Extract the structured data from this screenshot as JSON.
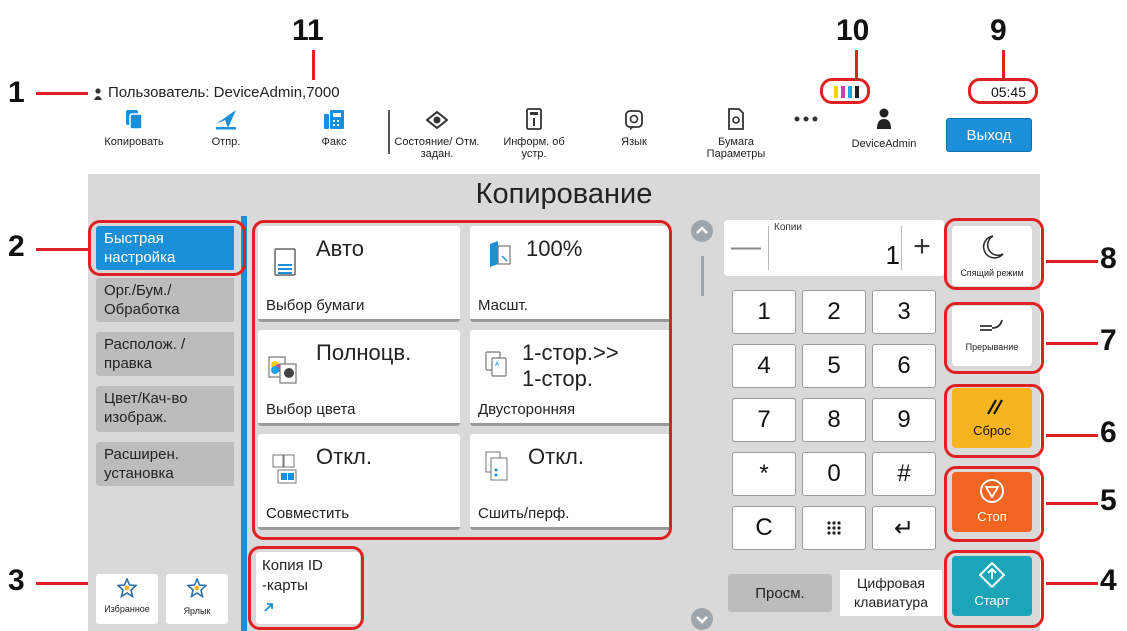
{
  "callouts": [
    "1",
    "2",
    "3",
    "4",
    "5",
    "6",
    "7",
    "8",
    "9",
    "10",
    "11"
  ],
  "status": {
    "user_text": "Пользователь: DeviceAdmin,7000",
    "time": "05:45",
    "toner_colors": [
      "#f2d200",
      "#d63bb0",
      "#1aa5e6",
      "#222222"
    ]
  },
  "toolbar": {
    "items": [
      {
        "label": "Копировать",
        "icon": "copy-icon"
      },
      {
        "label": "Отпр.",
        "icon": "send-icon"
      },
      {
        "label": "Факс",
        "icon": "fax-icon"
      },
      {
        "label": "Состояние/ Отм. задан.",
        "icon": "status-eye-icon"
      },
      {
        "label": "Информ. об устр.",
        "icon": "device-info-icon"
      },
      {
        "label": "Язык",
        "icon": "language-icon"
      },
      {
        "label": "Бумага Параметры",
        "icon": "paper-settings-icon"
      },
      {
        "label": "",
        "icon": "more-icon"
      },
      {
        "label": "DeviceAdmin",
        "icon": "user-icon"
      }
    ],
    "exit_label": "Выход"
  },
  "page_title": "Копирование",
  "tabs": [
    {
      "label": "Быстрая настройка",
      "active": true
    },
    {
      "label": "Орг./Бум./ Обработка"
    },
    {
      "label": "Располож. /правка"
    },
    {
      "label": "Цвет/Кач-во изображ."
    },
    {
      "label": "Расширен. установка"
    }
  ],
  "cards": [
    {
      "value": "Авто",
      "label": "Выбор бумаги",
      "icon": "paper-select-icon"
    },
    {
      "value": "100%",
      "label": "Масшт.",
      "icon": "zoom-icon"
    },
    {
      "value": "Полноцв.",
      "label": "Выбор цвета",
      "icon": "color-select-icon"
    },
    {
      "value": "1-стор.>> 1-стор.",
      "label": "Двусторонняя",
      "icon": "duplex-icon"
    },
    {
      "value": "Откл.",
      "label": "Совместить",
      "icon": "combine-icon"
    },
    {
      "value": "Откл.",
      "label": "Сшить/перф.",
      "icon": "staple-punch-icon"
    }
  ],
  "id_card": "Копия ID -карты",
  "favorites": {
    "fav_label": "Избранное",
    "shortcut_label": "Ярлык"
  },
  "copies": {
    "label": "Копии",
    "value": "1",
    "minus": "—",
    "plus": "+"
  },
  "keypad": [
    "1",
    "2",
    "3",
    "4",
    "5",
    "6",
    "7",
    "8",
    "9",
    "*",
    "0",
    "#",
    "C",
    "⁝⁝⁝",
    "↵"
  ],
  "preview_label": "Просм.",
  "digital_keyboard_label": "Цифровая клавиатура",
  "right_buttons": {
    "sleep": "Спящий режим",
    "interrupt": "Прерывание",
    "reset": "Сброс",
    "stop": "Стоп",
    "start": "Старт"
  },
  "colors": {
    "accent": "#1b8fd8",
    "reset": "#f6b51e",
    "stop": "#f26522",
    "start": "#1aa5b8",
    "callout": "#e02121"
  }
}
